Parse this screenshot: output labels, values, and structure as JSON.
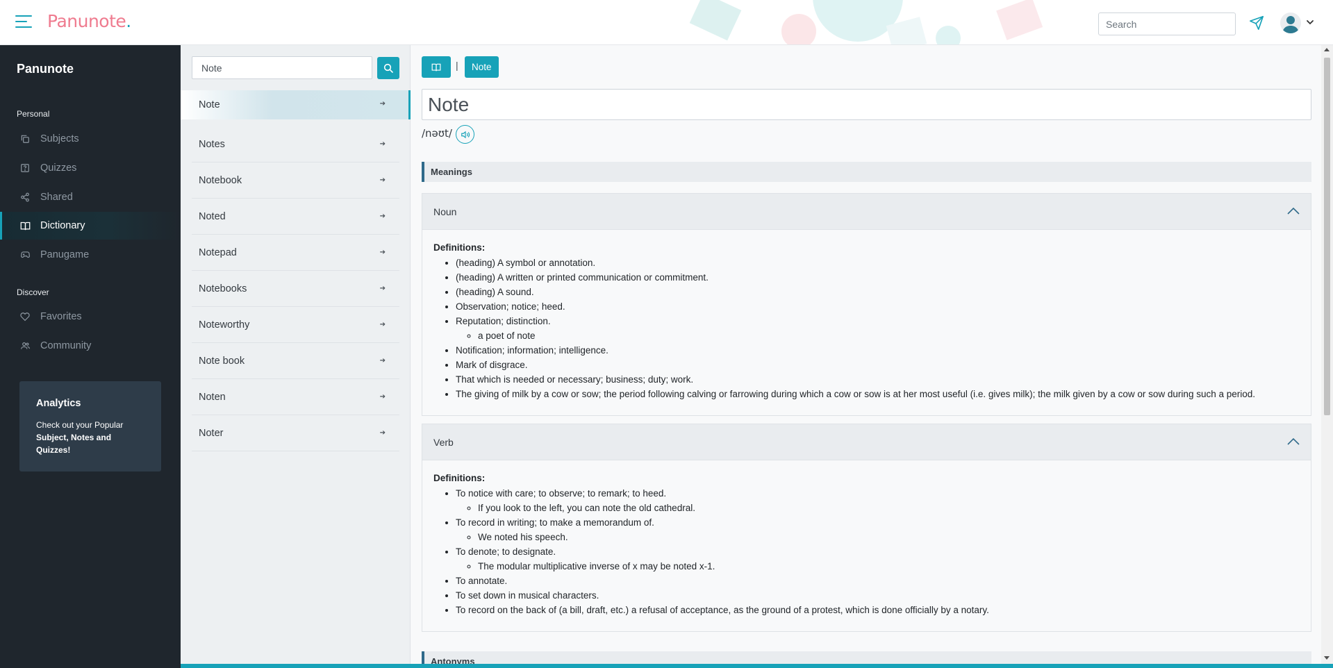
{
  "topbar": {
    "logo_text": "Panunote",
    "logo_dot": ".",
    "search_placeholder": "Search",
    "accent": "#17a2b8",
    "logo_color": "#ef7b8f"
  },
  "sidebar": {
    "brand": "Panunote",
    "personal_label": "Personal",
    "discover_label": "Discover",
    "personal_items": [
      {
        "label": "Subjects",
        "icon": "copy-icon"
      },
      {
        "label": "Quizzes",
        "icon": "question-square-icon"
      },
      {
        "label": "Shared",
        "icon": "share-icon"
      },
      {
        "label": "Dictionary",
        "icon": "book-icon",
        "active": true
      },
      {
        "label": "Panugame",
        "icon": "gamepad-icon"
      }
    ],
    "discover_items": [
      {
        "label": "Favorites",
        "icon": "heart-icon"
      },
      {
        "label": "Community",
        "icon": "users-icon"
      }
    ],
    "analytics": {
      "title": "Analytics",
      "text_before": "Check out your Popular ",
      "text_bold": "Subject, Notes and Quizzes!"
    }
  },
  "wordlist": {
    "search_value": "Note",
    "items": [
      "Note",
      "Notes",
      "Notebook",
      "Noted",
      "Notepad",
      "Notebooks",
      "Noteworthy",
      "Note book",
      "Noten",
      "Noter"
    ],
    "arrow": "➔"
  },
  "main": {
    "crumb_sep": "|",
    "crumb_word": "Note",
    "word": "Note",
    "phonetic": "/nəʊt/",
    "meanings_label": "Meanings",
    "antonyms_label": "Antonyms",
    "noun": {
      "title": "Noun",
      "defs_label": "Definitions:",
      "d1": "(heading) A symbol or annotation.",
      "d2": "(heading) A written or printed communication or commitment.",
      "d3": "(heading) A sound.",
      "d4": "Observation; notice; heed.",
      "d5": "Reputation; distinction.",
      "d5_ex": "a poet of note",
      "d6": "Notification; information; intelligence.",
      "d7": "Mark of disgrace.",
      "d8": "That which is needed or necessary; business; duty; work.",
      "d9": "The giving of milk by a cow or sow; the period following calving or farrowing during which a cow or sow is at her most useful (i.e. gives milk); the milk given by a cow or sow during such a period."
    },
    "verb": {
      "title": "Verb",
      "defs_label": "Definitions:",
      "d1": "To notice with care; to observe; to remark; to heed.",
      "d1_ex": "If you look to the left, you can note the old cathedral.",
      "d2": "To record in writing; to make a memorandum of.",
      "d2_ex": "We noted his speech.",
      "d3": "To denote; to designate.",
      "d3_ex": "The modular multiplicative inverse of x may be noted x-1.",
      "d4": "To annotate.",
      "d5": "To set down in musical characters.",
      "d6": "To record on the back of (a bill, draft, etc.) a refusal of acceptance, as the ground of a protest, which is done officially by a notary."
    }
  }
}
